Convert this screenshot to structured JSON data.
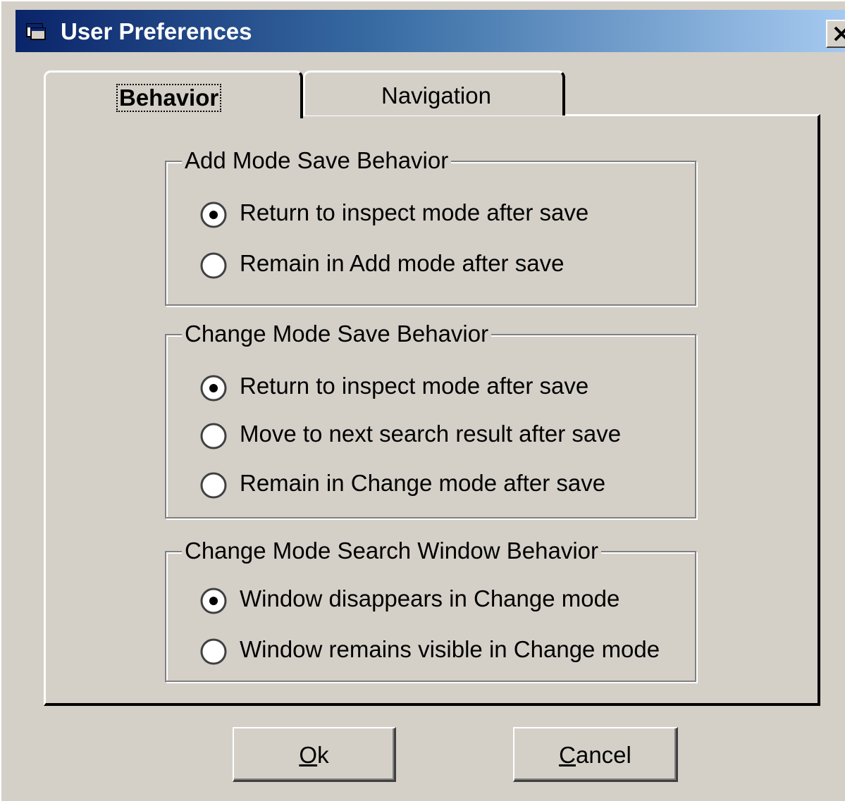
{
  "window": {
    "title": "User Preferences",
    "close_icon": "close-x-icon",
    "app_icon": "window-app-icon"
  },
  "tabs": [
    {
      "label": "Behavior",
      "active": true
    },
    {
      "label": "Navigation",
      "active": false
    }
  ],
  "groups": [
    {
      "title": "Add Mode Save Behavior",
      "options": [
        {
          "label": "Return to inspect mode after save",
          "selected": true
        },
        {
          "label": "Remain in Add mode after save",
          "selected": false
        }
      ]
    },
    {
      "title": "Change Mode Save Behavior",
      "options": [
        {
          "label": "Return to inspect mode after save",
          "selected": true
        },
        {
          "label": "Move to next search result after save",
          "selected": false
        },
        {
          "label": "Remain in Change mode after save",
          "selected": false
        }
      ]
    },
    {
      "title": "Change Mode Search Window Behavior",
      "options": [
        {
          "label": "Window disappears in Change mode",
          "selected": true
        },
        {
          "label": "Window remains visible in Change mode",
          "selected": false
        }
      ]
    }
  ],
  "buttons": {
    "ok": {
      "mnemonic": "O",
      "rest": "k"
    },
    "cancel": {
      "mnemonic": "C",
      "rest": "ancel"
    }
  }
}
